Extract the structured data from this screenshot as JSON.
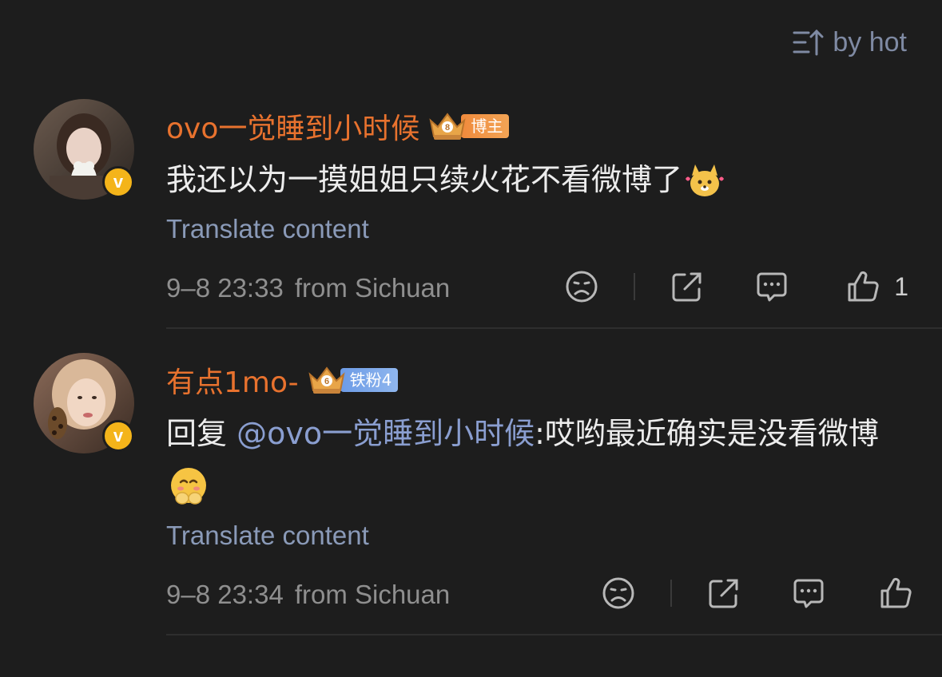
{
  "sort": {
    "label": "by hot",
    "icon": "sort-icon"
  },
  "colors": {
    "background": "#1d1d1d",
    "username": "#e8722e",
    "link": "#8a9ab8",
    "badge_verified": "#f4b41a"
  },
  "comments": [
    {
      "username": "ovo一觉睡到小时候",
      "badge_level": "8",
      "badge_tag": "博主",
      "verified_mark": "v",
      "text": "我还以为一摸姐姐只续火花不看微博了",
      "translate": "Translate content",
      "time": "9–8 23:33",
      "location": "from Sichuan",
      "like_count": "1"
    },
    {
      "username": "有点1mo-",
      "badge_level": "6",
      "badge_tag": "铁粉4",
      "verified_mark": "v",
      "reply_prefix": "回复 ",
      "mention": "@ovo一觉睡到小时候",
      "text": ":哎哟最近确实是没看微博",
      "translate": "Translate content",
      "time": "9–8 23:34",
      "location": "from Sichuan",
      "like_count": ""
    }
  ]
}
